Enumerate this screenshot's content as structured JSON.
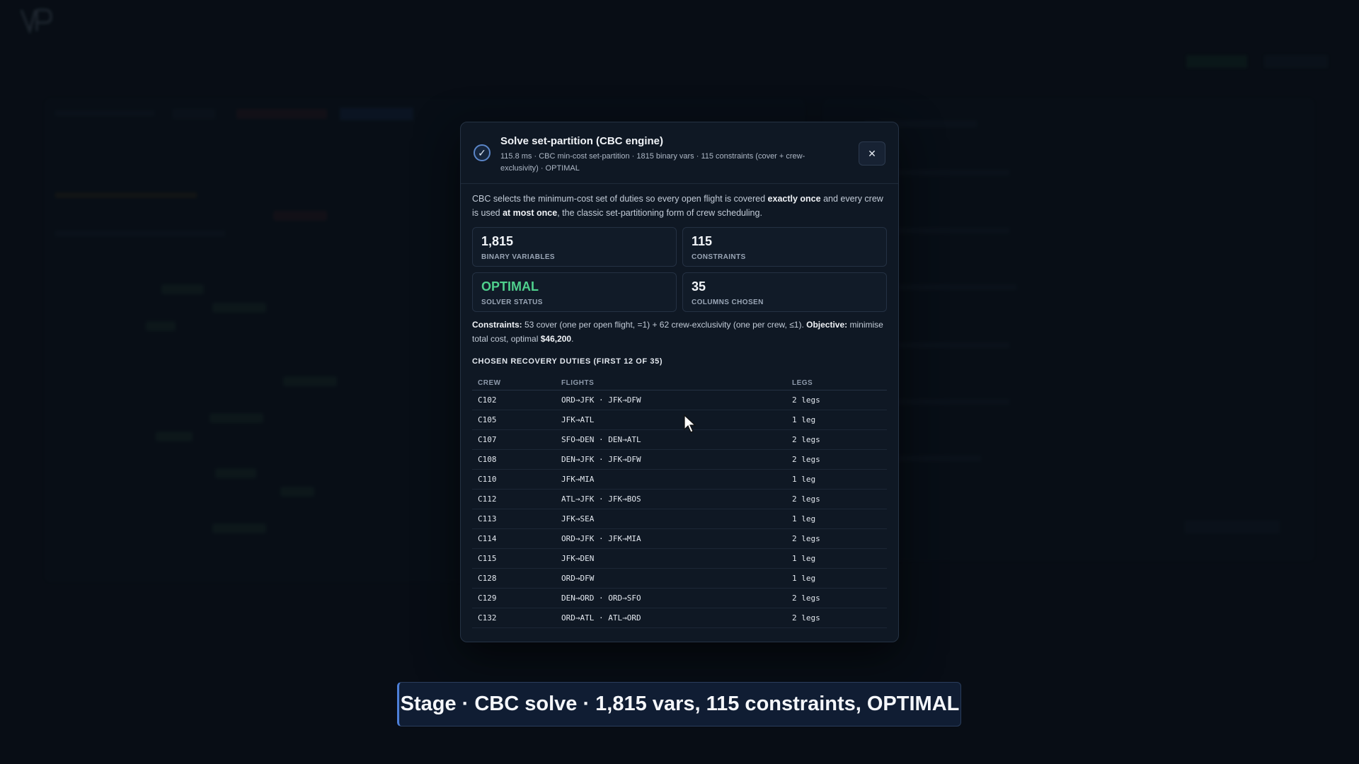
{
  "modal": {
    "title": "Solve set-partition (CBC engine)",
    "subtitle": "115.8 ms · CBC min-cost set-partition · 1815 binary vars · 115 constraints (cover + crew-exclusivity) · OPTIMAL",
    "description": {
      "p1": "CBC selects the minimum-cost set of duties so every open flight is covered ",
      "b1": "exactly once",
      "p2": " and every crew is used ",
      "b2": "at most once",
      "p3": ", the classic set-partitioning form of crew scheduling."
    },
    "stats": [
      {
        "value": "1,815",
        "label": "BINARY VARIABLES"
      },
      {
        "value": "115",
        "label": "CONSTRAINTS"
      },
      {
        "value": "OPTIMAL",
        "label": "SOLVER STATUS"
      },
      {
        "value": "35",
        "label": "COLUMNS CHOSEN"
      }
    ],
    "constraints": {
      "label": "Constraints:",
      "text": " 53 cover (one per open flight, =1) + 62 crew-exclusivity (one per crew, ≤1). ",
      "objective_label": "Objective:",
      "objective_text": " minimise total cost, optimal ",
      "objective_value": "$46,200",
      "end": "."
    },
    "section_title": "CHOSEN RECOVERY DUTIES (FIRST 12 OF 35)",
    "table": {
      "headers": [
        "CREW",
        "FLIGHTS",
        "LEGS"
      ],
      "rows": [
        {
          "crew": "C102",
          "flights": "ORD→JFK · JFK→DFW",
          "legs": "2 legs"
        },
        {
          "crew": "C105",
          "flights": "JFK→ATL",
          "legs": "1 leg"
        },
        {
          "crew": "C107",
          "flights": "SFO→DEN · DEN→ATL",
          "legs": "2 legs"
        },
        {
          "crew": "C108",
          "flights": "DEN→JFK · JFK→DFW",
          "legs": "2 legs"
        },
        {
          "crew": "C110",
          "flights": "JFK→MIA",
          "legs": "1 leg"
        },
        {
          "crew": "C112",
          "flights": "ATL→JFK · JFK→BOS",
          "legs": "2 legs"
        },
        {
          "crew": "C113",
          "flights": "JFK→SEA",
          "legs": "1 leg"
        },
        {
          "crew": "C114",
          "flights": "ORD→JFK · JFK→MIA",
          "legs": "2 legs"
        },
        {
          "crew": "C115",
          "flights": "JFK→DEN",
          "legs": "1 leg"
        },
        {
          "crew": "C128",
          "flights": "ORD→DFW",
          "legs": "1 leg"
        },
        {
          "crew": "C129",
          "flights": "DEN→ORD · ORD→SFO",
          "legs": "2 legs"
        },
        {
          "crew": "C132",
          "flights": "ORD→ATL · ATL→ORD",
          "legs": "2 legs"
        }
      ]
    },
    "icons": {
      "status": "check-circle-icon",
      "close": "close-icon"
    }
  },
  "caption": "Stage · CBC solve · 1,815 vars, 115 constraints, OPTIMAL",
  "colors": {
    "accent": "#4d7fd8",
    "optimal": "#4fd08d",
    "background": "#0b121c"
  }
}
